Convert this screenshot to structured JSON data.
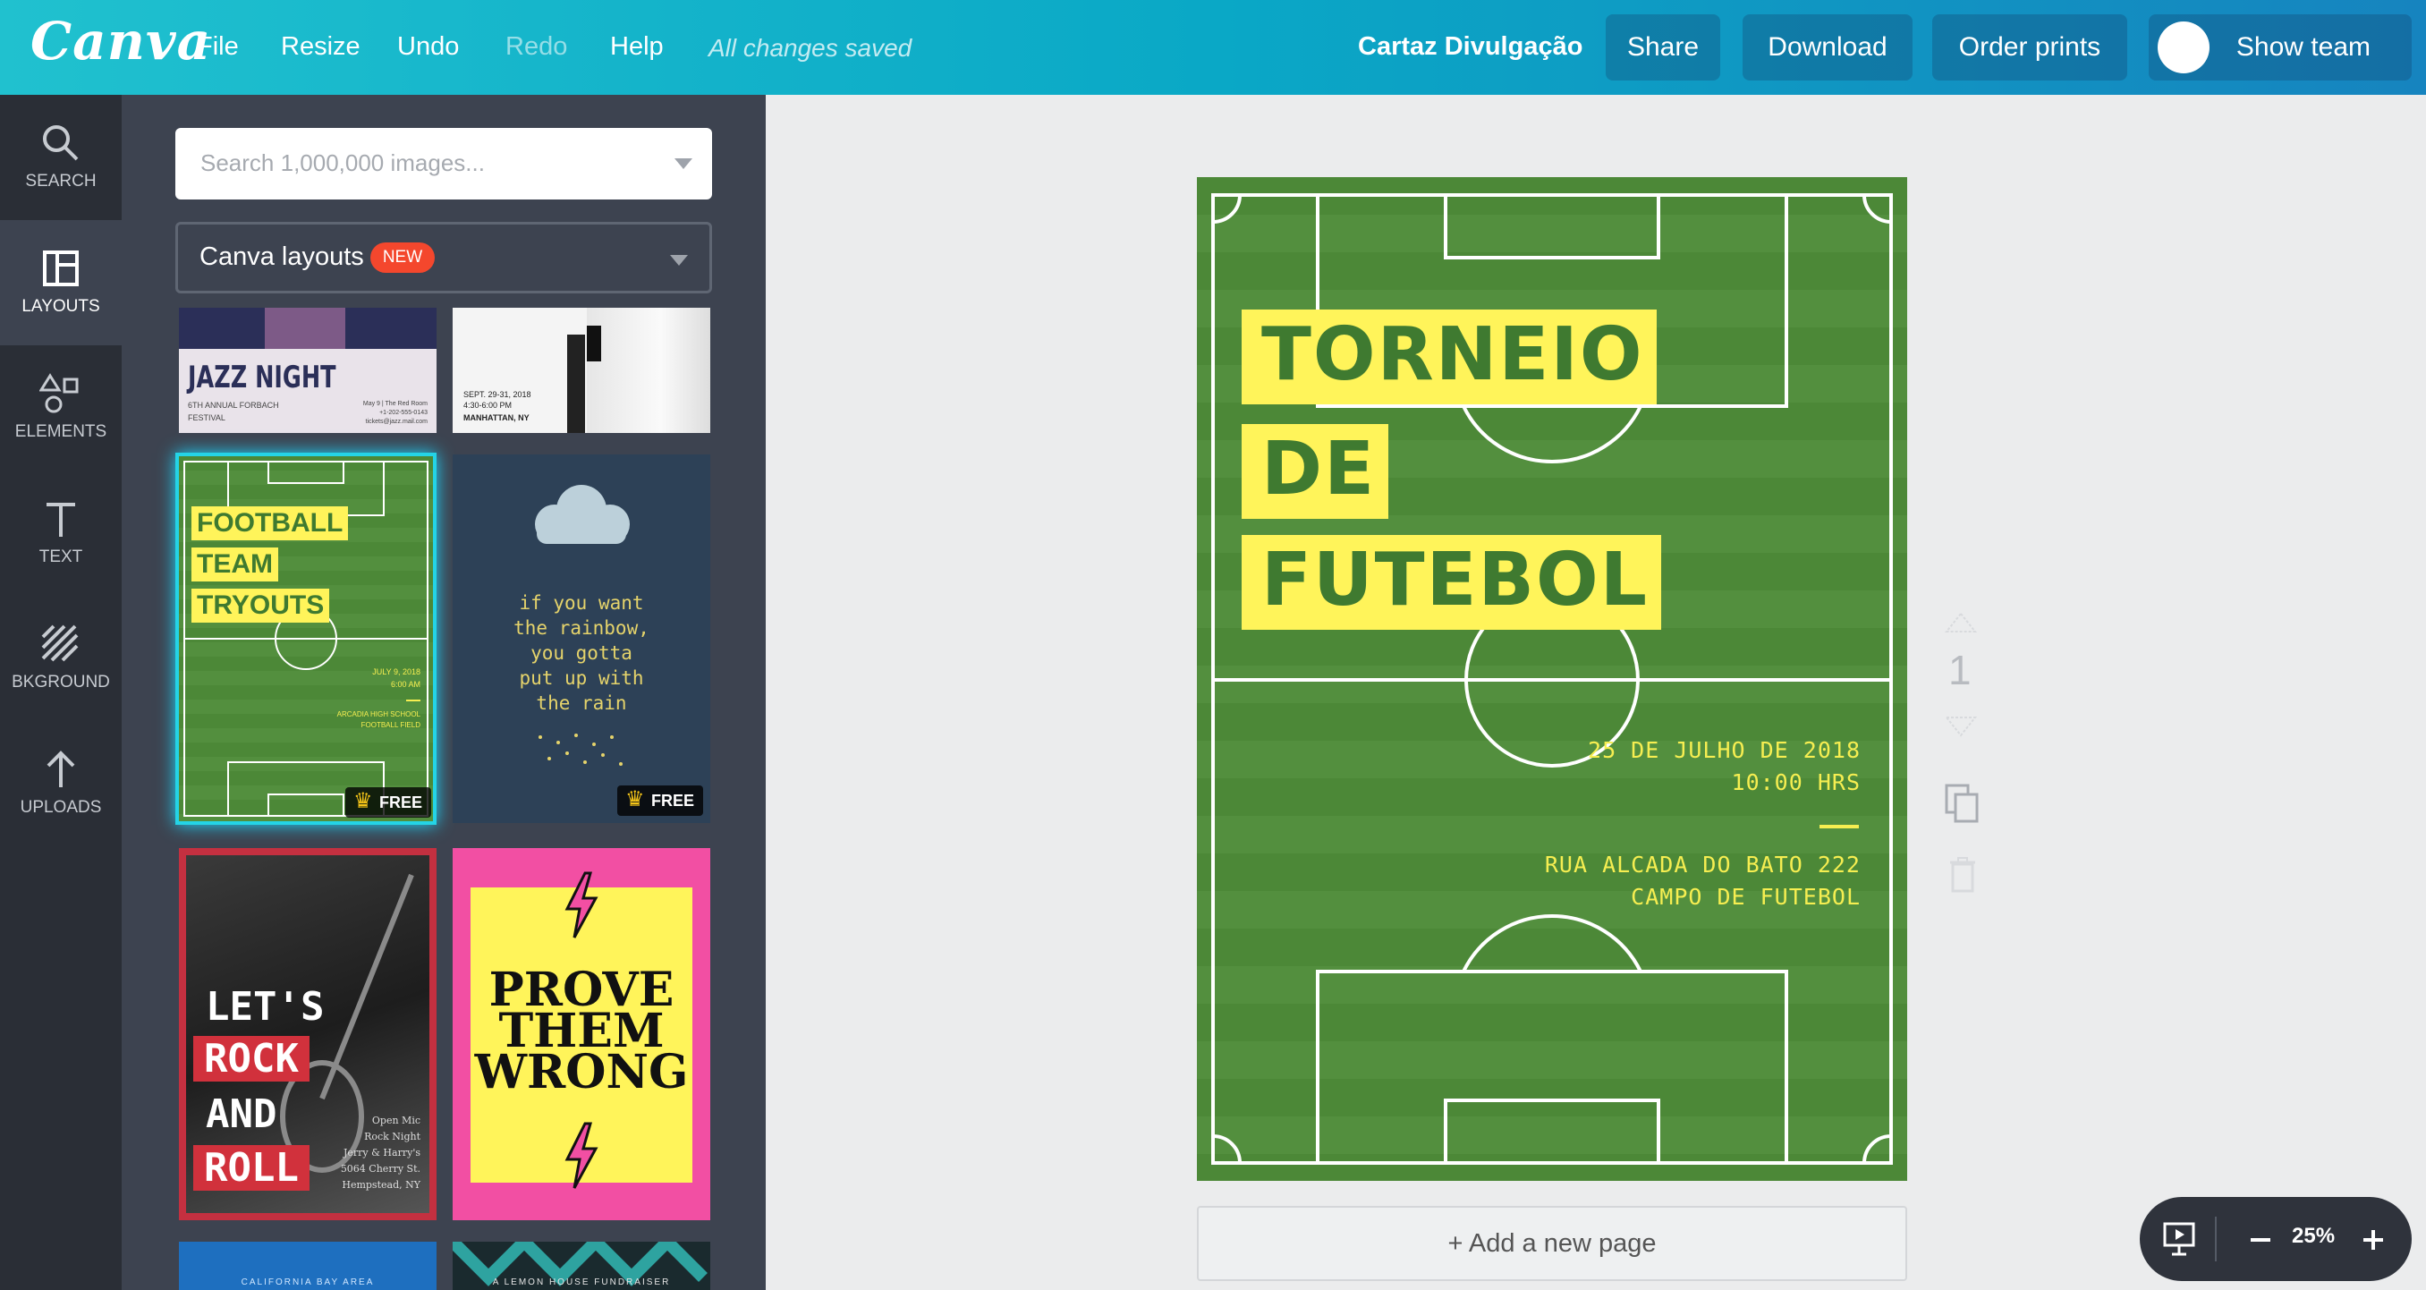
{
  "topbar": {
    "logo": "Canva",
    "menu": [
      "File",
      "Resize",
      "Undo",
      "Redo",
      "Help"
    ],
    "saved_status": "All changes saved",
    "doc_title": "Cartaz Divulgação",
    "share": "Share",
    "download": "Download",
    "order_prints": "Order prints",
    "show_team": "Show team"
  },
  "sidebar": {
    "items": [
      {
        "label": "SEARCH",
        "icon": "search-icon"
      },
      {
        "label": "LAYOUTS",
        "icon": "layouts-icon"
      },
      {
        "label": "ELEMENTS",
        "icon": "elements-icon"
      },
      {
        "label": "TEXT",
        "icon": "text-icon"
      },
      {
        "label": "BKGROUND",
        "icon": "background-icon"
      },
      {
        "label": "UPLOADS",
        "icon": "upload-icon"
      }
    ],
    "active": "LAYOUTS"
  },
  "panel": {
    "search_placeholder": "Search 1,000,000 images...",
    "dropdown_label": "Canva layouts",
    "new_badge": "NEW",
    "free_badge": "FREE",
    "templates": {
      "jazz": {
        "title": "JAZZ NIGHT",
        "sub1": "6TH ANNUAL FORBACH",
        "sub2": "FESTIVAL",
        "info1": "May 9 | The Red Room",
        "info2": "+1-202-555-0143",
        "info3": "tickets@jazz.mail.com"
      },
      "bw": {
        "l1": "SEPT. 29-31, 2018",
        "l2": "4:30-6:00 PM",
        "l3": "MANHATTAN, NY"
      },
      "football": {
        "l1": "FOOTBALL",
        "l2": "TEAM",
        "l3": "TRYOUTS",
        "date": "JULY 9, 2018",
        "time": "6:00 AM",
        "place1": "ARCADIA HIGH SCHOOL",
        "place2": "FOOTBALL FIELD"
      },
      "rain": {
        "lines": [
          "if you want",
          "the rainbow,",
          "you gotta",
          "put up with",
          "the rain"
        ]
      },
      "rock": {
        "w1": "LET'S",
        "w2": "ROCK",
        "w3": "AND",
        "w4": "ROLL",
        "info": [
          "Open Mic",
          "Rock Night",
          "Jerry & Harry's",
          "5064 Cherry St.",
          "Hempstead, NY"
        ]
      },
      "prove": {
        "l1": "PROVE",
        "l2": "THEM",
        "l3": "WRONG"
      },
      "bottom1": "CALIFORNIA BAY AREA",
      "bottom2": "A LEMON HOUSE FUNDRAISER"
    }
  },
  "poster": {
    "title": [
      "TORNEIO",
      "DE",
      "FUTEBOL"
    ],
    "date": "25 DE JULHO DE 2018",
    "time": "10:00 HRS",
    "address1": "RUA ALCADA DO BATO 222",
    "address2": "CAMPO DE FUTEBOL",
    "colors": {
      "field": "#4e8a3a",
      "highlight": "#fff45a",
      "text": "#3f7a30"
    }
  },
  "canvas": {
    "add_page": "+ Add a new page",
    "page_number": "1",
    "zoom": "25%"
  }
}
